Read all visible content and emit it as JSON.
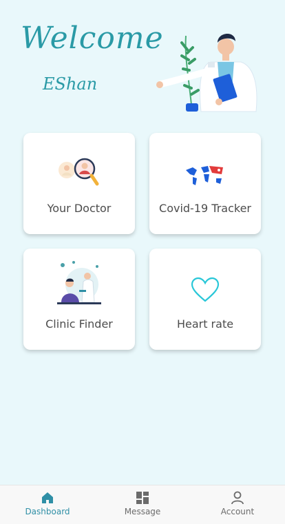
{
  "header": {
    "welcome": "Welcome",
    "user_name": "EShan"
  },
  "cards": [
    {
      "label": "Your Doctor"
    },
    {
      "label": "Covid-19 Tracker"
    },
    {
      "label": "Clinic Finder"
    },
    {
      "label": "Heart rate"
    }
  ],
  "nav": {
    "items": [
      {
        "label": "Dashboard",
        "icon": "home-icon",
        "active": true
      },
      {
        "label": "Message",
        "icon": "grid-icon",
        "active": false
      },
      {
        "label": "Account",
        "icon": "person-icon",
        "active": false
      }
    ]
  },
  "colors": {
    "accent": "#2a9aa6",
    "nav_active": "#2f8fa6",
    "background": "#e9f8fb",
    "heart": "#29c7d8"
  }
}
